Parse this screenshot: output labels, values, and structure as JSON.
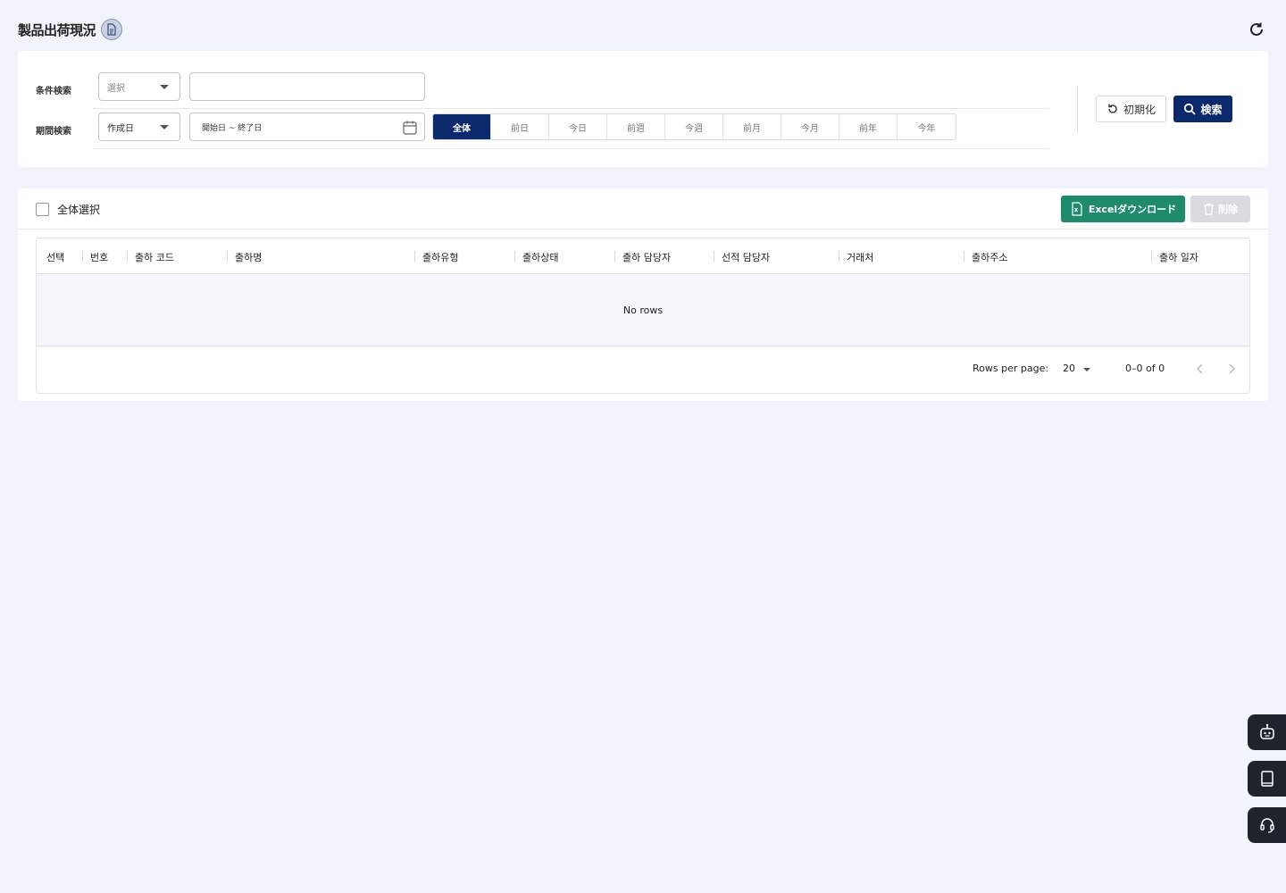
{
  "header": {
    "title": "製品出荷現況"
  },
  "search": {
    "condition_label": "条件検索",
    "condition_select": "選択",
    "condition_input_placeholder": "",
    "period_label": "期間検索",
    "period_select": "作成日",
    "date_range": "開始日 ~ 終了日",
    "period_buttons": [
      "全体",
      "前日",
      "今日",
      "前週",
      "今週",
      "前月",
      "今月",
      "前年",
      "今年"
    ],
    "active_period": "全体",
    "reset_label": "初期化",
    "search_label": "検索"
  },
  "grid": {
    "select_all_label": "全体選択",
    "excel_label": "Excelダウンロード",
    "delete_label": "削除",
    "columns": [
      "선택",
      "번호",
      "출하 코드",
      "출하명",
      "출하유형",
      "출하상태",
      "출하 담당자",
      "선적 담당자",
      "거래처",
      "출하주소",
      "출하 일자"
    ],
    "empty_text": "No rows",
    "rows_per_page_label": "Rows per page:",
    "rows_per_page": "20",
    "range_text": "0–0 of 0"
  },
  "colors": {
    "primary": "#0c2a6b",
    "excel": "#1f8a6c",
    "background": "#f1f4fa",
    "float_btn": "#1f232b"
  },
  "float_buttons": [
    "chatbot-icon",
    "manual-icon",
    "support-headset-icon"
  ]
}
